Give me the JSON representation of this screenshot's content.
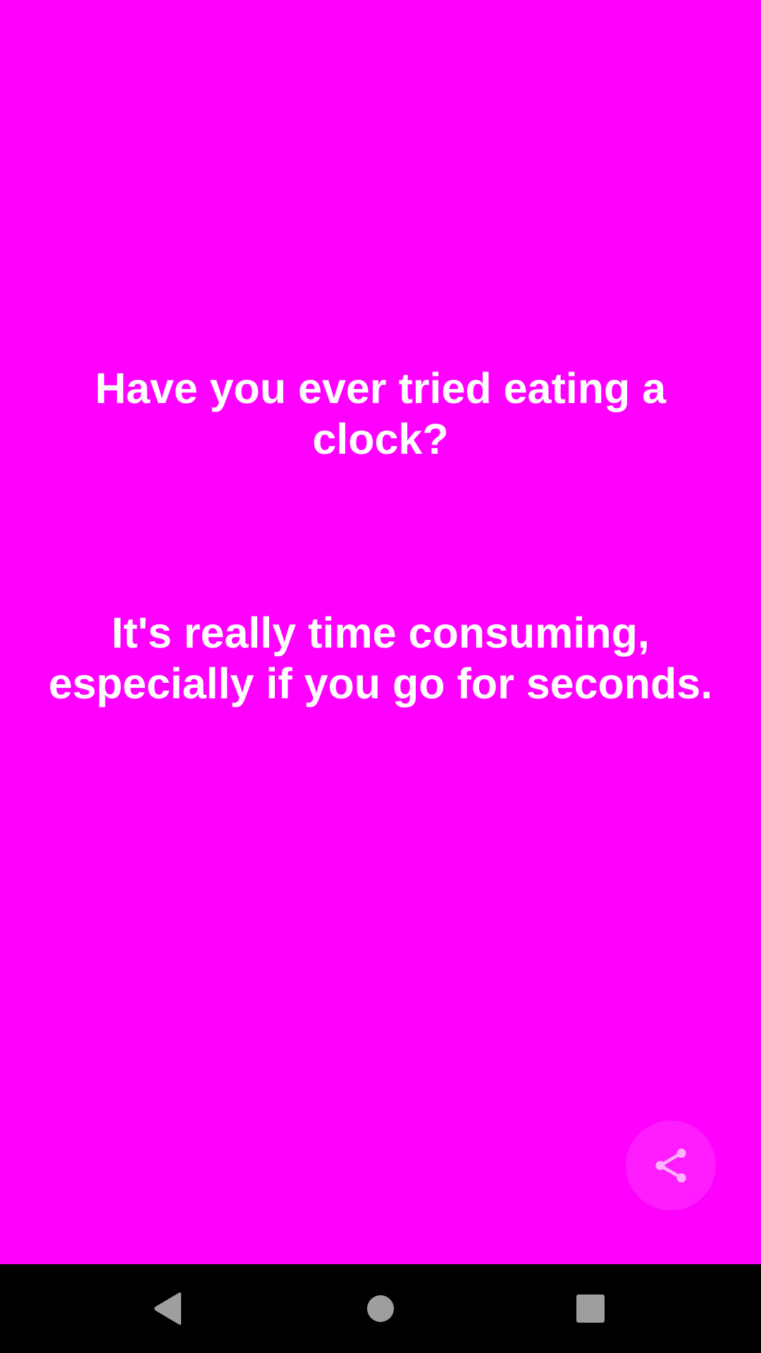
{
  "joke": {
    "setup": "Have you ever tried eating a clock?",
    "punchline_line1": "It's really time consuming,",
    "punchline_line2": "especially if you go for seconds."
  },
  "colors": {
    "background": "#ff00ff",
    "text": "#ffffff",
    "fab_icon": "#ffb3ff",
    "nav_bar": "#000000",
    "nav_icons": "#9e9e9e"
  },
  "icons": {
    "fab": "share-icon",
    "nav_back": "back-triangle-icon",
    "nav_home": "home-circle-icon",
    "nav_recents": "recents-square-icon"
  }
}
